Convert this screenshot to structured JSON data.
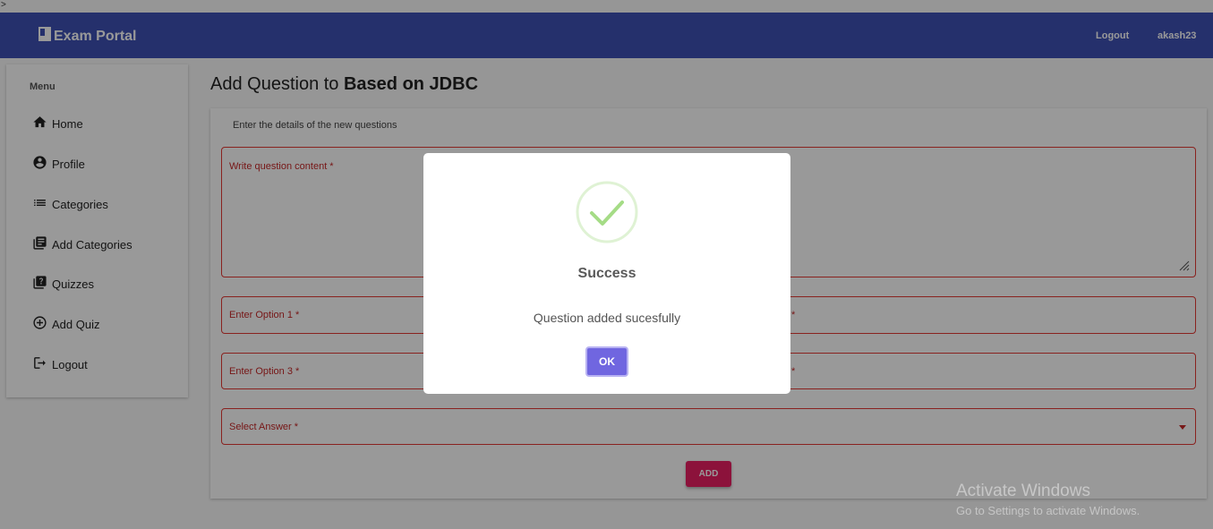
{
  "stray_char": ">",
  "navbar": {
    "brand": "Exam Portal",
    "logout": "Logout",
    "username": "akash23"
  },
  "sidebar": {
    "title": "Menu",
    "items": [
      {
        "label": "Home",
        "icon": "home-icon"
      },
      {
        "label": "Profile",
        "icon": "account-circle-icon"
      },
      {
        "label": "Categories",
        "icon": "list-icon"
      },
      {
        "label": "Add Categories",
        "icon": "library-books-icon"
      },
      {
        "label": "Quizzes",
        "icon": "quiz-icon"
      },
      {
        "label": "Add Quiz",
        "icon": "add-circle-icon"
      },
      {
        "label": "Logout",
        "icon": "logout-icon"
      }
    ]
  },
  "page": {
    "title_prefix": "Add Question to ",
    "title_bold": "Based on JDBC"
  },
  "form": {
    "subtitle": "Enter the details of the new questions",
    "content_label": "Write question content *",
    "option1_label": "Enter Option 1 *",
    "option2_label": "*",
    "option3_label": "Enter Option 3 *",
    "option4_label": "*",
    "answer_label": "Select Answer *",
    "add_button": "ADD"
  },
  "dialog": {
    "title": "Success",
    "text": "Question added sucesfully",
    "ok": "OK"
  },
  "watermark": {
    "title": "Activate Windows",
    "subtitle": "Go to Settings to activate Windows."
  },
  "colors": {
    "primary": "#3f51b5",
    "accent": "#e91e63",
    "error": "#e53935",
    "success": "#a5dc86",
    "confirm": "#7066e0"
  }
}
